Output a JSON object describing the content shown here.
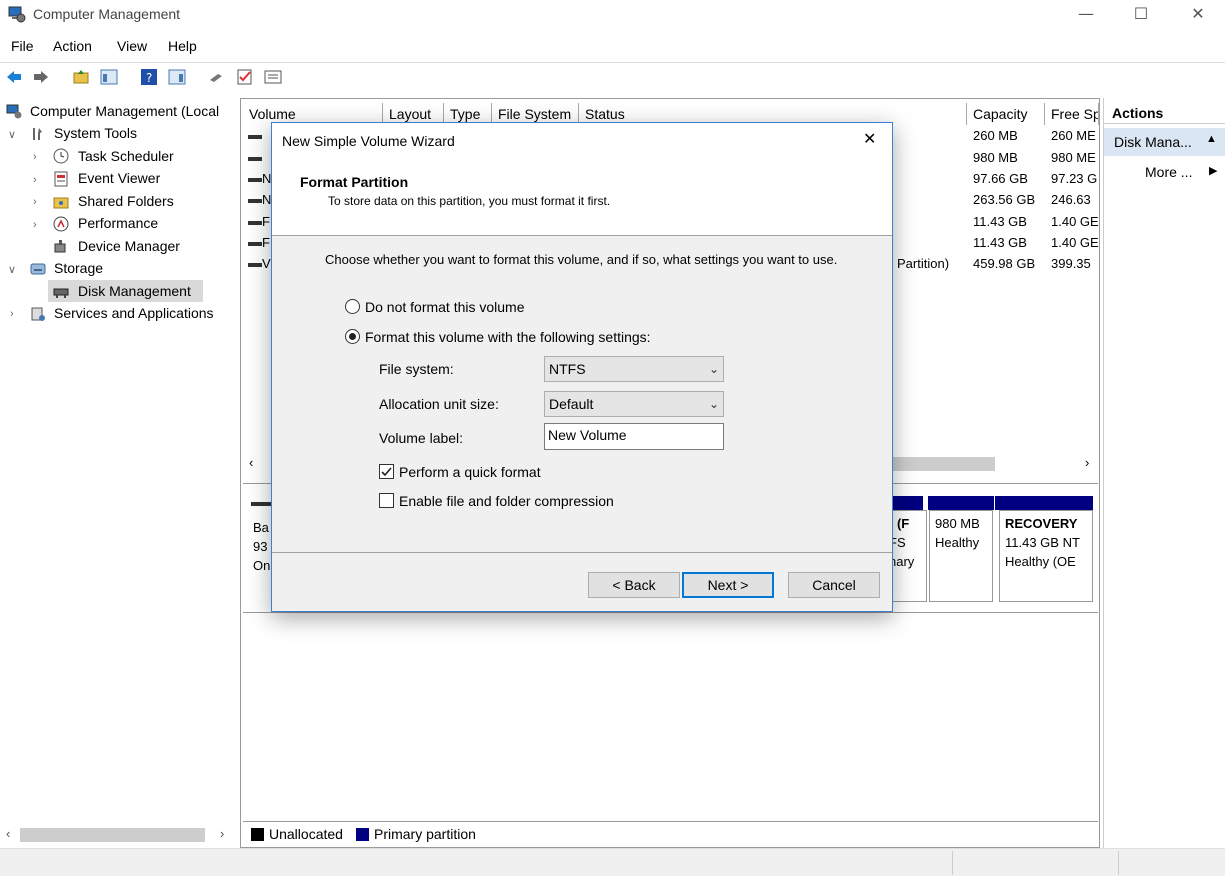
{
  "window": {
    "title": "Computer Management",
    "minimize": "—",
    "maximize": "☐",
    "close": "✕"
  },
  "menu": [
    "File",
    "Action",
    "View",
    "Help"
  ],
  "tree": {
    "root": "Computer Management (Local",
    "system_tools": "System Tools",
    "task_scheduler": "Task Scheduler",
    "event_viewer": "Event Viewer",
    "shared_folders": "Shared Folders",
    "performance": "Performance",
    "device_manager": "Device Manager",
    "storage": "Storage",
    "disk_management": "Disk Management",
    "services": "Services and Applications"
  },
  "volume_table": {
    "columns": [
      "Volume",
      "Layout",
      "Type",
      "File System",
      "Status",
      "Capacity",
      "Free Sp"
    ],
    "status_fragment": "Partition)",
    "row_letters": [
      "",
      "",
      "N",
      "N",
      "F",
      "F",
      "V"
    ],
    "capacity": [
      "260 MB",
      "980 MB",
      "97.66 GB",
      "263.56 GB",
      "11.43 GB",
      "11.43 GB",
      "459.98 GB"
    ],
    "free": [
      "260 ME",
      "980 ME",
      "97.23 G",
      "246.63",
      "1.40 GE",
      "1.40 GE",
      "399.35"
    ]
  },
  "disk_view": {
    "disk_lines": [
      "Ba",
      "93",
      "On"
    ],
    "partition_a_lines": [
      ": (F",
      "FS",
      "nary"
    ],
    "partition_b_lines": [
      "",
      "980 MB",
      "Healthy"
    ],
    "recovery_lines": [
      "RECOVERY",
      "11.43 GB NT",
      "Healthy (OE"
    ]
  },
  "legend": {
    "unallocated": "Unallocated",
    "primary": "Primary partition"
  },
  "actions": {
    "header": "Actions",
    "disk_mgmt": "Disk Mana...",
    "more": "More ..."
  },
  "wizard": {
    "title": "New Simple Volume Wizard",
    "heading": "Format Partition",
    "subheading": "To store data on this partition, you must format it first.",
    "instruction": "Choose whether you want to format this volume, and if so, what settings you want to use.",
    "opt_no_format": "Do not format this volume",
    "opt_format": "Format this volume with the following settings:",
    "file_system_label": "File system:",
    "file_system_value": "NTFS",
    "alloc_label": "Allocation unit size:",
    "alloc_value": "Default",
    "volume_label_label": "Volume label:",
    "volume_label_value": "New Volume",
    "quick_format": "Perform a quick format",
    "compression": "Enable file and folder compression",
    "back": "< Back",
    "next": "Next >",
    "cancel": "Cancel"
  },
  "colors": {
    "primary_partition": "#000080",
    "accent": "#0078d7"
  }
}
